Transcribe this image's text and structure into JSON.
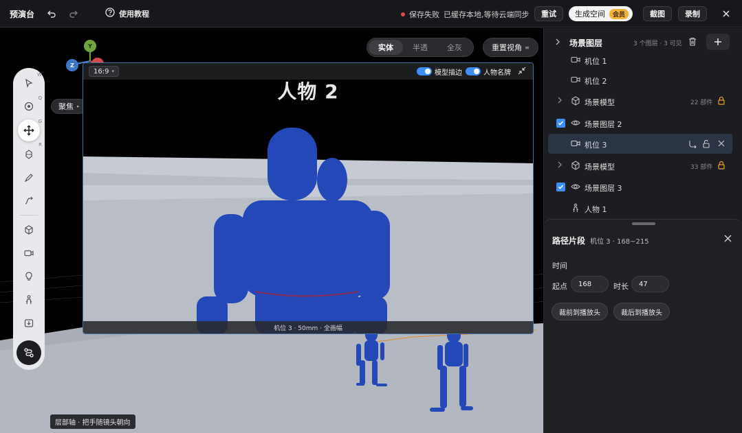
{
  "topbar": {
    "app_title": "预演台",
    "help_label": "使用教程",
    "save_status": "保存失败",
    "save_note": "已缓存本地,等待云端同步",
    "retry_label": "重试",
    "space_label": "生成空间",
    "vip_badge": "会员",
    "screenshot_label": "截图",
    "record_label": "录制"
  },
  "viewport": {
    "focus_chip": "聚焦",
    "gizmo_y": "Y",
    "gizmo_z": "Z",
    "render_modes": [
      "实体",
      "半透",
      "全灰"
    ],
    "active_render_mode": "实体",
    "reset_view_label": "重置视角",
    "tool_badges": [
      "W",
      "Q",
      "G",
      "R"
    ],
    "hint": "层部轴 · 把手随镜头朝向"
  },
  "preview": {
    "ratio": "16:9",
    "outline_label": "模型描边",
    "nameplate_label": "人物名牌",
    "title": "人物 2",
    "footer": "机位 3 · 50mm · 全画幅"
  },
  "scene_panel": {
    "title": "场景图层",
    "meta": "3 个图层 · 3 可见",
    "rows": [
      {
        "label": "机位 1",
        "kind": "camera"
      },
      {
        "label": "机位 2",
        "kind": "camera"
      },
      {
        "label": "场景模型",
        "kind": "model",
        "count": "22 部件"
      },
      {
        "label": "场景图层 2",
        "kind": "layer"
      },
      {
        "label": "机位 3",
        "kind": "camera",
        "selected": true
      },
      {
        "label": "场景模型",
        "kind": "model",
        "count": "33 部件"
      },
      {
        "label": "场景图层 3",
        "kind": "layer"
      },
      {
        "label": "人物 1",
        "kind": "person"
      }
    ]
  },
  "path_panel": {
    "title": "路径片段",
    "subtitle": "机位 3 · 168~215",
    "section": "时间",
    "start_label": "起点",
    "start_value": "168",
    "duration_label": "时长",
    "duration_value": "47",
    "crop_before_label": "裁前到播放头",
    "crop_after_label": "裁后到播放头"
  },
  "colors": {
    "accent": "#3b8ff5",
    "figure": "#2448b8",
    "warning": "#f0a020",
    "error": "#e5484d"
  }
}
